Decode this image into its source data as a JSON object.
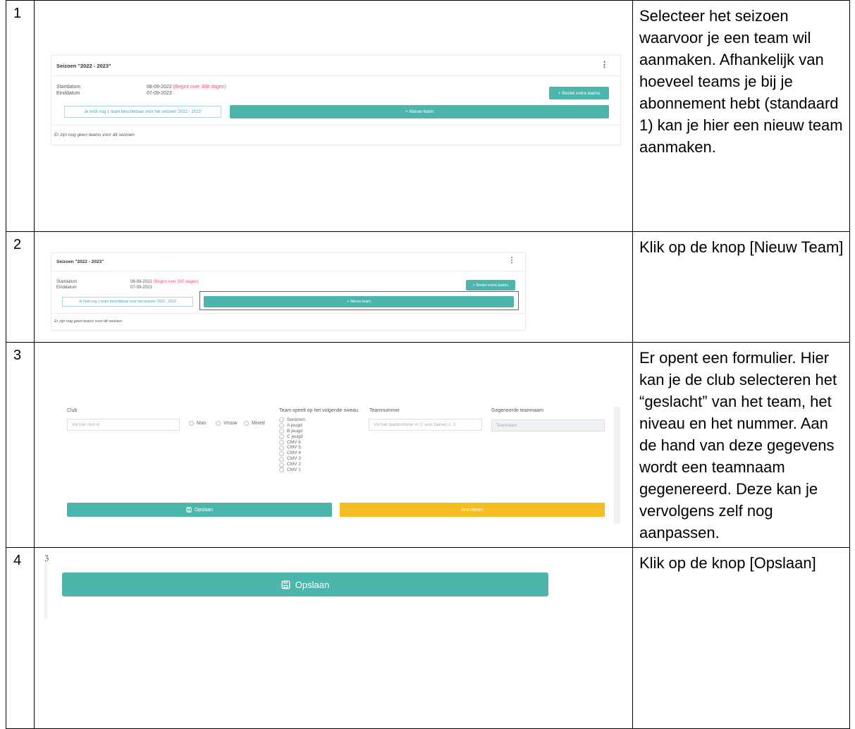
{
  "steps": [
    {
      "number": "1",
      "description": "Selecteer het seizoen waarvoor je een team wil aanmaken. Afhankelijk van hoeveel teams je bij je abonnement hebt (standaard 1) kan je hier een nieuw team aanmaken."
    },
    {
      "number": "2",
      "description": "Klik op de knop [Nieuw Team]"
    },
    {
      "number": "3",
      "description": "Er opent een formulier. Hier kan je de club selecteren het “geslacht” van het team, het niveau en het nummer. Aan de hand van deze gegevens wordt een teamnaam gegenereerd. Deze kan je vervolgens zelf nog aanpassen."
    },
    {
      "number": "4",
      "description": "Klik op de knop [Opslaan]"
    }
  ],
  "season_card": {
    "title": "Seizoen \"2022 - 2023\"",
    "menu_icon": "vertical-dots-icon",
    "start_label": "Startdatum",
    "end_label": "Einddatum",
    "start_date": "08-09-2022",
    "start_note": "(Begint over 308 dagen)",
    "start_note_alt": "(Begint over 300 dagen)",
    "end_date": "07-09-2023",
    "order_button": "+ Bestel extra teams",
    "available_text": "Je hebt nog 1 team beschikbaar voor het seizoen '2022 - 2023'",
    "new_team_button": "+ Nieuw team",
    "empty_text": "Er zijn nog geen teams voor dit seizoen"
  },
  "form": {
    "club_label": "Club",
    "club_placeholder": "Vul hier club in",
    "gender_options": [
      "Man",
      "Vrouw",
      "Mixed"
    ],
    "level_label": "Team speelt op het volgende niveau",
    "levels": [
      "Senioren",
      "A jeugd",
      "B jeugd",
      "C jeugd",
      "CMV 6",
      "CMV 5",
      "CMV 4",
      "CMV 3",
      "CMV 2",
      "CMV 1"
    ],
    "teamnumber_label": "Teamnummer",
    "teamnumber_placeholder": "Vul hier teamnummer in (1 voor Dames 1, 3",
    "generated_label": "Gegeneerde teamnaam",
    "generated_placeholder": "Teamnaam",
    "save_button": "Opslaan",
    "cancel_button": "Annuleren"
  },
  "colors": {
    "teal": "#4db6ac",
    "yellow": "#f5bd1f",
    "red_note": "#f0506e",
    "highlight": "#d9343a"
  }
}
